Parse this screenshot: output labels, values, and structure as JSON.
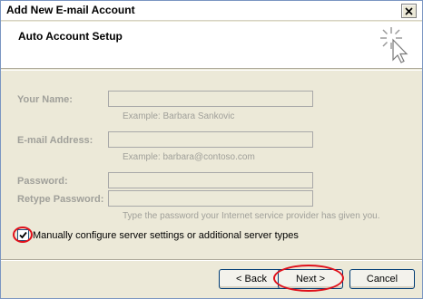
{
  "window": {
    "title": "Add New E-mail Account"
  },
  "header": {
    "title": "Auto Account Setup"
  },
  "form": {
    "name": {
      "label": "Your Name:",
      "value": "",
      "hint": "Example: Barbara Sankovic"
    },
    "email": {
      "label": "E-mail Address:",
      "value": "",
      "hint": "Example: barbara@contoso.com"
    },
    "password": {
      "label": "Password:",
      "value": ""
    },
    "retype_password": {
      "label": "Retype Password:",
      "value": ""
    },
    "password_hint": "Type the password your Internet service provider has given you."
  },
  "manual_config": {
    "label": "Manually configure server settings or additional server types",
    "checked": true
  },
  "buttons": {
    "back": "< Back",
    "next": "Next >",
    "cancel": "Cancel"
  },
  "colors": {
    "highlight": "#e0101a",
    "disabled_text": "#a0a09a"
  }
}
